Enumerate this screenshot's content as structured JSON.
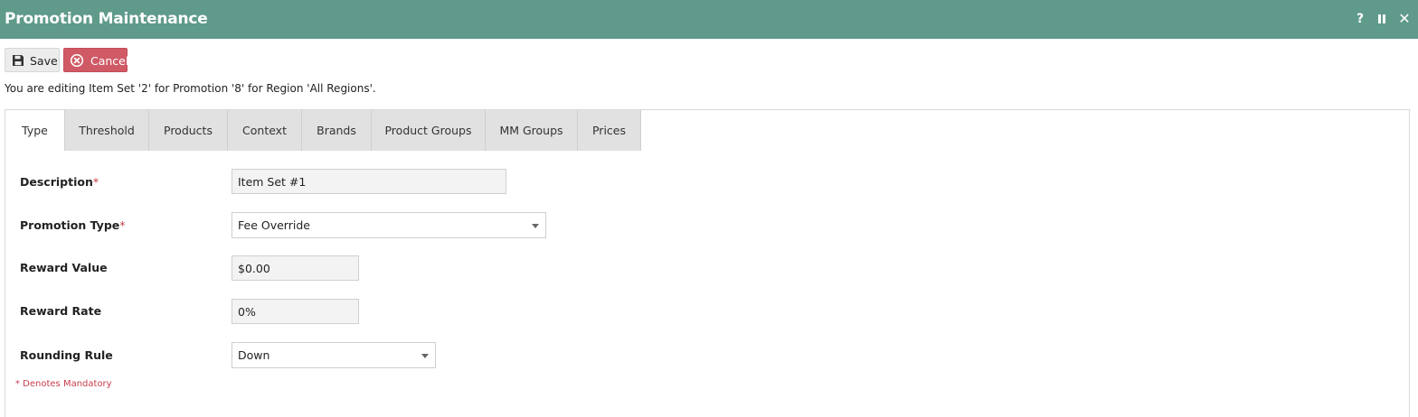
{
  "window": {
    "title": "Promotion Maintenance",
    "help_label": "?",
    "close_label": "✕"
  },
  "toolbar": {
    "save_label": "Save",
    "cancel_label": "Cancel"
  },
  "info_text": "You are editing Item Set '2' for Promotion '8' for Region 'All Regions'.",
  "tabs": [
    {
      "label": "Type",
      "active": true
    },
    {
      "label": "Threshold"
    },
    {
      "label": "Products"
    },
    {
      "label": "Context"
    },
    {
      "label": "Brands"
    },
    {
      "label": "Product Groups"
    },
    {
      "label": "MM Groups"
    },
    {
      "label": "Prices"
    }
  ],
  "form": {
    "description": {
      "label": "Description",
      "required_mark": "*",
      "value": "Item Set #1"
    },
    "promotion_type": {
      "label": "Promotion Type",
      "required_mark": "*",
      "value": "Fee Override"
    },
    "reward_value": {
      "label": "Reward Value",
      "value": "$0.00"
    },
    "reward_rate": {
      "label": "Reward Rate",
      "value": "0%"
    },
    "rounding_rule": {
      "label": "Rounding Rule",
      "value": "Down"
    }
  },
  "mandatory_note": "* Denotes Mandatory",
  "colors": {
    "titlebar": "#5f9a8b",
    "cancel": "#cf5a66",
    "required": "#c93c4c"
  }
}
